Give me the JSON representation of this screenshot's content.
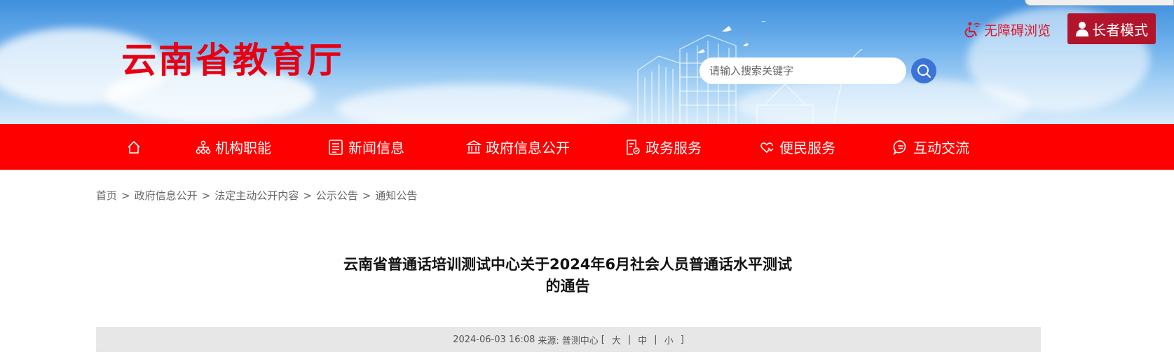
{
  "header": {
    "site_name": "云南省教育厅",
    "search_placeholder": "请输入搜索关键字",
    "accessibility_label": "无障碍浏览",
    "elder_mode_label": "长者模式"
  },
  "nav": {
    "items": [
      {
        "label": "",
        "icon": "home-icon"
      },
      {
        "label": "机构职能",
        "icon": "org-chart-icon"
      },
      {
        "label": "新闻信息",
        "icon": "newspaper-icon"
      },
      {
        "label": "政府信息公开",
        "icon": "government-building-icon"
      },
      {
        "label": "政务服务",
        "icon": "service-document-icon"
      },
      {
        "label": "便民服务",
        "icon": "heart-hand-icon"
      },
      {
        "label": "互动交流",
        "icon": "chat-bubble-icon"
      }
    ]
  },
  "breadcrumb": {
    "items": [
      "首页",
      "政府信息公开",
      "法定主动公开内容",
      "公示公告",
      "通知公告"
    ],
    "separator": ">"
  },
  "article": {
    "title_line1": "云南省普通话培训测试中心关于2024年6月社会人员普通话水平测试",
    "title_line2": "的通告",
    "date": "2024-06-03 16:08",
    "source_label": "来源:",
    "source": "普测中心",
    "font_size_open": "[",
    "font_large": "大",
    "font_medium": "中",
    "font_small": "小",
    "font_size_close": "]",
    "font_sep": "|"
  },
  "colors": {
    "nav_background": "#ff0000",
    "logo_red": "#e60012",
    "elder_button": "#b2152b",
    "search_button": "#3b74d8"
  }
}
